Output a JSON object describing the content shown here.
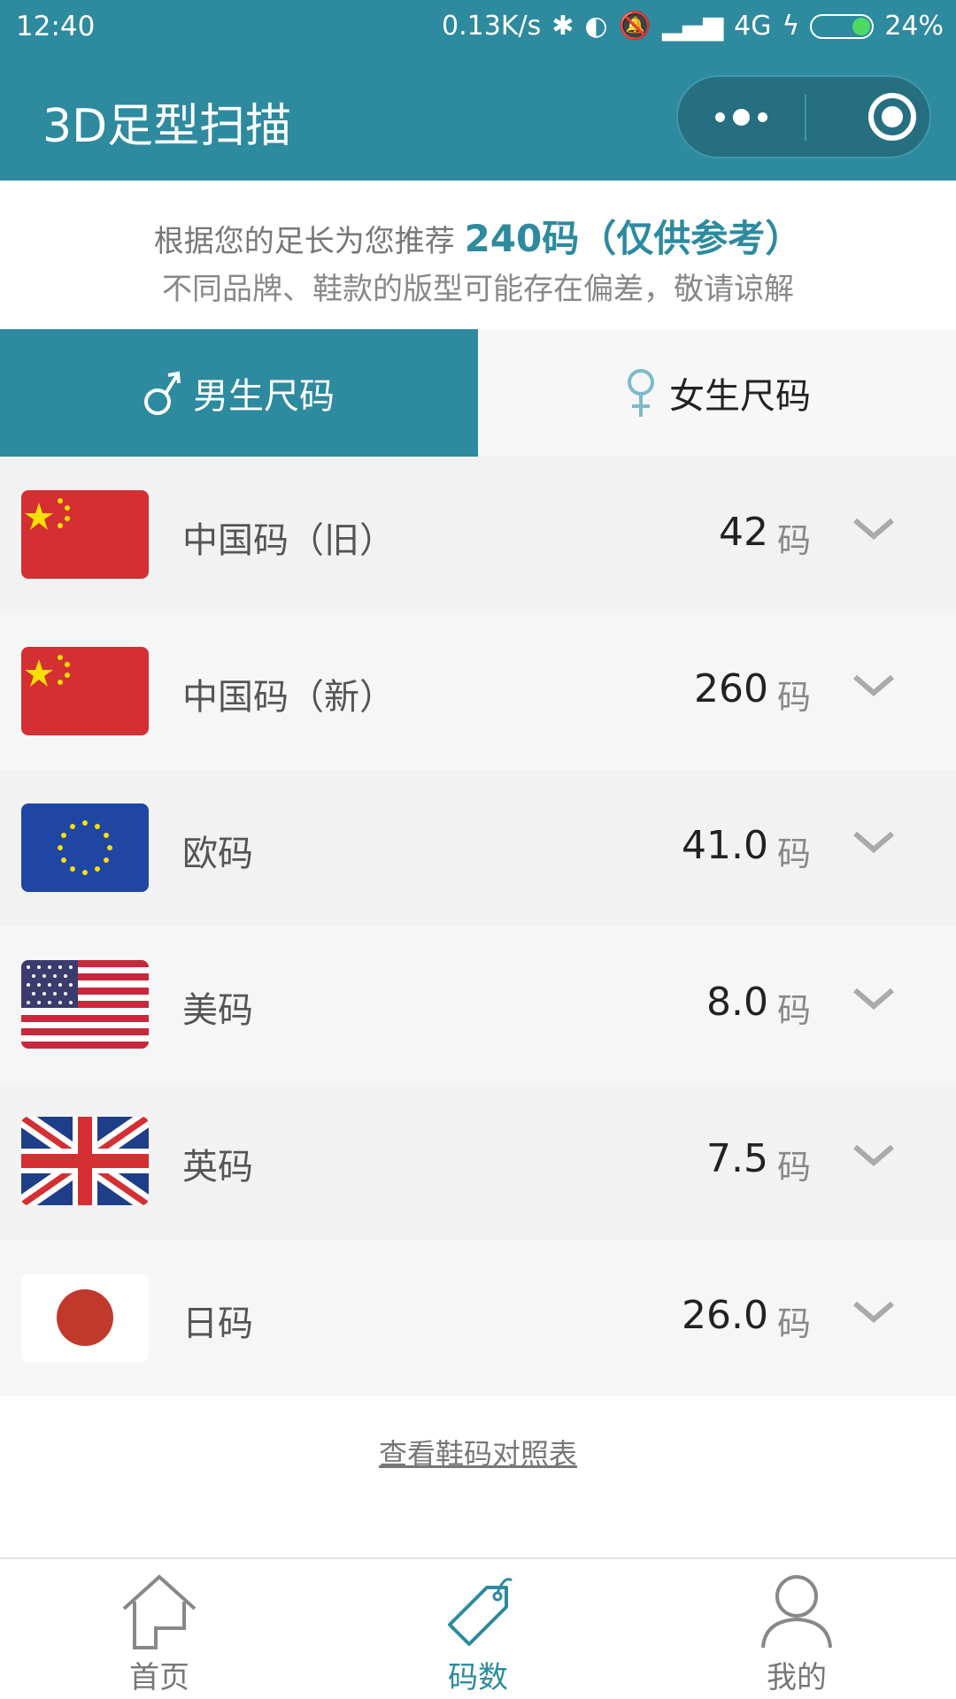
{
  "status_bar": {
    "time": "12:40",
    "speed": "0.13K/s",
    "network": "4G",
    "battery": "24%",
    "battery_level": 0.24
  },
  "nav": {
    "title": "3D足型扫描"
  },
  "recommendation": {
    "prefix": "根据您的足长为您推荐",
    "size": "240码（仅供参考）",
    "note": "不同品牌、鞋款的版型可能存在偏差，敬请谅解"
  },
  "gender_tabs": [
    {
      "label": "男生尺码",
      "icon": "male-icon",
      "active": true
    },
    {
      "label": "女生尺码",
      "icon": "female-icon",
      "active": false
    }
  ],
  "sizes": [
    {
      "country": "中国码（旧）",
      "value": "42",
      "unit": "码",
      "flag": "china-flag-icon"
    },
    {
      "country": "中国码（新）",
      "value": "260",
      "unit": "码",
      "flag": "china-flag-icon"
    },
    {
      "country": "欧码",
      "value": "41.0",
      "unit": "码",
      "flag": "eu-flag-icon"
    },
    {
      "country": "美码",
      "value": "8.0",
      "unit": "码",
      "flag": "us-flag-icon"
    },
    {
      "country": "英码",
      "value": "7.5",
      "unit": "码",
      "flag": "uk-flag-icon"
    },
    {
      "country": "日码",
      "value": "26.0",
      "unit": "码",
      "flag": "japan-flag-icon"
    }
  ],
  "chart_link": "查看鞋码对照表",
  "tab_bar": [
    {
      "label": "首页",
      "icon": "home-icon",
      "active": false
    },
    {
      "label": "码数",
      "icon": "tag-icon",
      "active": true
    },
    {
      "label": "我的",
      "icon": "user-icon",
      "active": false
    }
  ],
  "colors": {
    "accent": "#2e8a9e",
    "flag_red": "#d42f33",
    "flag_yellow": "#f6e000"
  }
}
